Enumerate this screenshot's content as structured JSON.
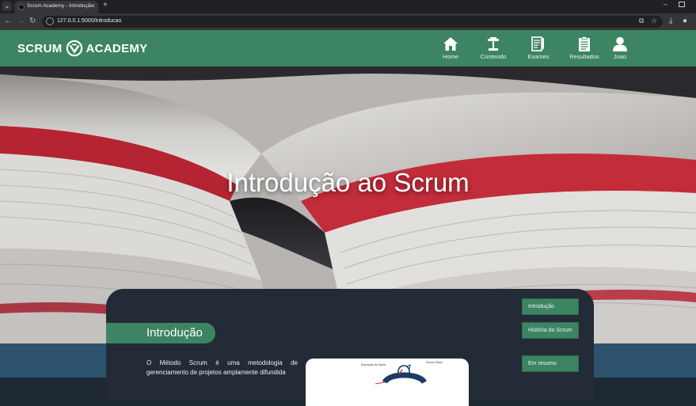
{
  "browser": {
    "tab_title": "Scrum Academy - Introdução",
    "url": "127.0.0.1:5000/introducao"
  },
  "header": {
    "brand_left": "SCRUM",
    "brand_right": "ACADEMY",
    "nav": [
      {
        "label": "Home",
        "icon": "home-icon"
      },
      {
        "label": "Conteúdo",
        "icon": "podium-icon"
      },
      {
        "label": "Exames",
        "icon": "exam-icon"
      },
      {
        "label": "Resultados",
        "icon": "clipboard-icon"
      },
      {
        "label": "Joao",
        "icon": "user-icon"
      }
    ]
  },
  "hero": {
    "title": "Introdução ao Scrum"
  },
  "content": {
    "section_title": "Introdução",
    "intro_text": "O Método Scrum é uma metodologia de gerenciamento de projetos amplamente difundida",
    "diagram_labels": [
      "Execução do Sprint",
      "Scrum Diário"
    ]
  },
  "side_nav": [
    {
      "label": "Introdução"
    },
    {
      "label": "História do Scrum"
    },
    {
      "label": "Em resumo"
    }
  ],
  "colors": {
    "header_green": "#3d8462",
    "card_dark": "#232b36",
    "band_blue": "#2c526e"
  }
}
